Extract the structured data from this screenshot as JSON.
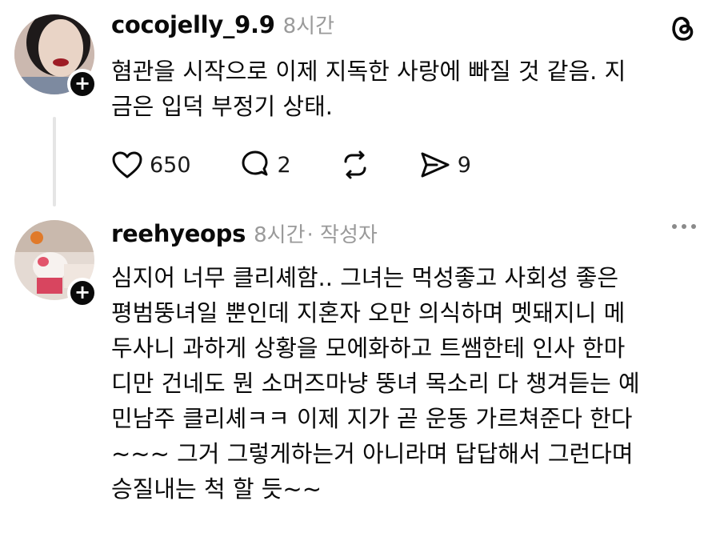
{
  "posts": [
    {
      "username": "cocojelly_9.9",
      "time": "8시간",
      "body": "혐관을 시작으로 이제 지독한 사랑에 빠질 것 같음. 지\n금은 입덕 부정기 상태.",
      "actions": {
        "likes": "650",
        "replies": "2",
        "shares": "9"
      },
      "icons": [
        "heart-icon",
        "reply-icon",
        "repost-icon",
        "share-icon",
        "threads-logo-icon"
      ]
    },
    {
      "username": "reehyeops",
      "time": "8시간",
      "author_tag": "· 작성자",
      "body": "심지어 너무 클리셰함.. 그녀는 먹성좋고 사회성 좋은\n평범뚱녀일 뿐인데 지혼자 오만 의식하며 멧돼지니 메\n두사니 과하게 상황을 모에화하고 트쌤한테 인사 한마\n디만 건네도 뭔 소머즈마냥 뚱녀 목소리 다 챙겨듣는 예\n민남주 클리셰ㅋㅋ 이제 지가 곧 운동 가르쳐준다 한다\n~~~ 그거 그렇게하는거 아니라며 답답해서 그런다며\n승질내는 척 할 듯~~",
      "icons": [
        "more-options-icon"
      ]
    }
  ],
  "colors": {
    "text": "#0a0a0a",
    "muted": "#9a9a9a",
    "badge": "#0a0a0a",
    "thread_line": "#e5e5e5"
  }
}
